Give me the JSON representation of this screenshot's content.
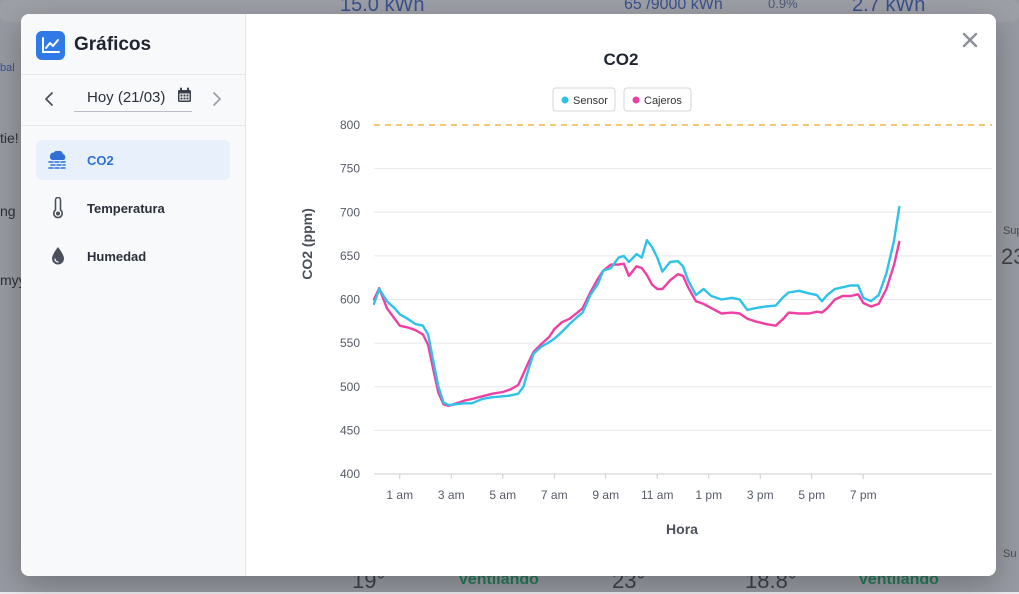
{
  "background": {
    "fragments": [
      "15.0 kWh",
      "65 /9000 kWh",
      "0.9%",
      "2.7 kWh",
      "bal",
      "tie!",
      "ng",
      "myy",
      "Sup",
      "23",
      "Su",
      "19°",
      "Ventilando",
      "23°",
      "18.8°",
      "Ventilando"
    ]
  },
  "app": {
    "title": "Gráficos",
    "icon": "line-chart-icon"
  },
  "date": {
    "label": "Hoy (21/03)",
    "prev_icon": "chevron-left-icon",
    "next_icon": "chevron-right-icon",
    "calendar_icon": "calendar-icon"
  },
  "menu": [
    {
      "label": "CO2",
      "icon": "cloud-icon",
      "active": true
    },
    {
      "label": "Temperatura",
      "icon": "thermometer-icon",
      "active": false
    },
    {
      "label": "Humedad",
      "icon": "droplet-icon",
      "active": false
    }
  ],
  "close_icon": "close-icon",
  "colors": {
    "accent": "#2f7ae6",
    "sensor": "#2fc1e8",
    "cajeros": "#ef3fa3",
    "threshold": "#f2b54a"
  },
  "chart_data": {
    "type": "line",
    "title": "CO2",
    "xlabel": "Hora",
    "ylabel": "CO2 (ppm)",
    "ylim": [
      400,
      800
    ],
    "yticks": [
      400,
      450,
      500,
      550,
      600,
      650,
      700,
      750,
      800
    ],
    "xlim": [
      0,
      24
    ],
    "xticks": [
      {
        "x": 1,
        "label": "1 am"
      },
      {
        "x": 3,
        "label": "3 am"
      },
      {
        "x": 5,
        "label": "5 am"
      },
      {
        "x": 7,
        "label": "7 am"
      },
      {
        "x": 9,
        "label": "9 am"
      },
      {
        "x": 11,
        "label": "11 am"
      },
      {
        "x": 13,
        "label": "1 pm"
      },
      {
        "x": 15,
        "label": "3 pm"
      },
      {
        "x": 17,
        "label": "5 pm"
      },
      {
        "x": 19,
        "label": "7 pm"
      }
    ],
    "grid": true,
    "legend_position": "top-center",
    "threshold": 800,
    "series": [
      {
        "name": "Sensor",
        "color": "#2fc1e8",
        "points": [
          [
            0,
            595
          ],
          [
            0.2,
            612
          ],
          [
            0.5,
            598
          ],
          [
            0.8,
            590
          ],
          [
            1.0,
            583
          ],
          [
            1.3,
            578
          ],
          [
            1.6,
            572
          ],
          [
            1.9,
            570
          ],
          [
            2.1,
            560
          ],
          [
            2.3,
            530
          ],
          [
            2.5,
            500
          ],
          [
            2.7,
            482
          ],
          [
            2.9,
            479
          ],
          [
            3.2,
            480
          ],
          [
            3.5,
            481
          ],
          [
            3.8,
            481
          ],
          [
            4.2,
            486
          ],
          [
            4.6,
            488
          ],
          [
            5.0,
            489
          ],
          [
            5.3,
            490
          ],
          [
            5.6,
            492
          ],
          [
            5.8,
            500
          ],
          [
            6.0,
            520
          ],
          [
            6.2,
            538
          ],
          [
            6.5,
            546
          ],
          [
            6.8,
            551
          ],
          [
            7.0,
            555
          ],
          [
            7.3,
            563
          ],
          [
            7.6,
            572
          ],
          [
            7.9,
            580
          ],
          [
            8.1,
            585
          ],
          [
            8.4,
            605
          ],
          [
            8.7,
            618
          ],
          [
            8.9,
            633
          ],
          [
            9.2,
            636
          ],
          [
            9.5,
            648
          ],
          [
            9.7,
            650
          ],
          [
            9.9,
            643
          ],
          [
            10.2,
            652
          ],
          [
            10.4,
            648
          ],
          [
            10.6,
            668
          ],
          [
            10.8,
            660
          ],
          [
            11.0,
            648
          ],
          [
            11.2,
            632
          ],
          [
            11.5,
            643
          ],
          [
            11.8,
            644
          ],
          [
            12.0,
            638
          ],
          [
            12.2,
            622
          ],
          [
            12.5,
            605
          ],
          [
            12.8,
            612
          ],
          [
            13.1,
            604
          ],
          [
            13.5,
            600
          ],
          [
            13.9,
            602
          ],
          [
            14.2,
            600
          ],
          [
            14.5,
            588
          ],
          [
            14.8,
            590
          ],
          [
            15.2,
            592
          ],
          [
            15.6,
            593
          ],
          [
            15.9,
            603
          ],
          [
            16.1,
            608
          ],
          [
            16.5,
            610
          ],
          [
            16.9,
            607
          ],
          [
            17.2,
            605
          ],
          [
            17.4,
            598
          ],
          [
            17.6,
            605
          ],
          [
            17.9,
            612
          ],
          [
            18.2,
            614
          ],
          [
            18.5,
            616
          ],
          [
            18.8,
            616
          ],
          [
            19.0,
            602
          ],
          [
            19.3,
            598
          ],
          [
            19.6,
            605
          ],
          [
            19.9,
            630
          ],
          [
            20.2,
            668
          ],
          [
            20.4,
            706
          ]
        ]
      },
      {
        "name": "Cajeros",
        "color": "#ef3fa3",
        "points": [
          [
            0,
            600
          ],
          [
            0.2,
            613
          ],
          [
            0.5,
            590
          ],
          [
            0.8,
            578
          ],
          [
            1.0,
            570
          ],
          [
            1.3,
            568
          ],
          [
            1.6,
            565
          ],
          [
            1.9,
            560
          ],
          [
            2.1,
            548
          ],
          [
            2.3,
            520
          ],
          [
            2.5,
            493
          ],
          [
            2.7,
            480
          ],
          [
            2.9,
            478
          ],
          [
            3.2,
            481
          ],
          [
            3.5,
            484
          ],
          [
            3.8,
            486
          ],
          [
            4.2,
            489
          ],
          [
            4.6,
            492
          ],
          [
            5.0,
            494
          ],
          [
            5.3,
            497
          ],
          [
            5.6,
            502
          ],
          [
            5.8,
            515
          ],
          [
            6.0,
            528
          ],
          [
            6.2,
            540
          ],
          [
            6.5,
            549
          ],
          [
            6.8,
            557
          ],
          [
            7.0,
            566
          ],
          [
            7.3,
            574
          ],
          [
            7.6,
            578
          ],
          [
            7.9,
            585
          ],
          [
            8.1,
            590
          ],
          [
            8.4,
            608
          ],
          [
            8.7,
            624
          ],
          [
            8.9,
            633
          ],
          [
            9.2,
            640
          ],
          [
            9.5,
            640
          ],
          [
            9.7,
            641
          ],
          [
            9.9,
            627
          ],
          [
            10.2,
            638
          ],
          [
            10.4,
            636
          ],
          [
            10.6,
            628
          ],
          [
            10.8,
            617
          ],
          [
            11.0,
            612
          ],
          [
            11.2,
            612
          ],
          [
            11.5,
            622
          ],
          [
            11.8,
            629
          ],
          [
            12.0,
            627
          ],
          [
            12.2,
            614
          ],
          [
            12.5,
            598
          ],
          [
            12.8,
            595
          ],
          [
            13.1,
            590
          ],
          [
            13.5,
            584
          ],
          [
            13.9,
            585
          ],
          [
            14.2,
            584
          ],
          [
            14.5,
            578
          ],
          [
            14.8,
            575
          ],
          [
            15.2,
            572
          ],
          [
            15.6,
            570
          ],
          [
            15.9,
            578
          ],
          [
            16.1,
            585
          ],
          [
            16.5,
            584
          ],
          [
            16.9,
            584
          ],
          [
            17.2,
            586
          ],
          [
            17.4,
            585
          ],
          [
            17.6,
            590
          ],
          [
            17.9,
            600
          ],
          [
            18.2,
            604
          ],
          [
            18.5,
            604
          ],
          [
            18.8,
            606
          ],
          [
            19.0,
            596
          ],
          [
            19.3,
            592
          ],
          [
            19.6,
            595
          ],
          [
            19.9,
            612
          ],
          [
            20.2,
            640
          ],
          [
            20.4,
            666
          ]
        ]
      }
    ]
  }
}
